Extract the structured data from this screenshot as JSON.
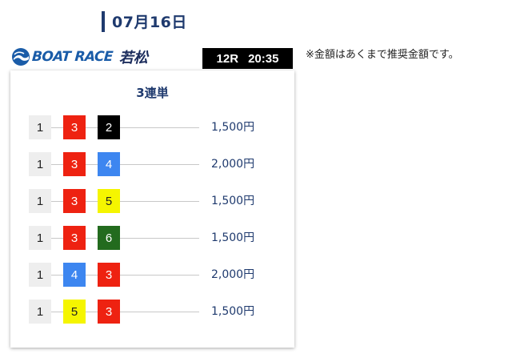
{
  "header": {
    "date": "07月16日"
  },
  "logo": {
    "text": "BOAT RACE",
    "venue": "若松",
    "icon": "boat-race-wave-icon"
  },
  "race": {
    "number": "12R",
    "time": "20:35"
  },
  "note": "※金額はあくまで推奨金額です。",
  "card": {
    "title": "3連単",
    "rows": [
      {
        "first": "1",
        "second": "3",
        "third": "2",
        "amount": "1,500円"
      },
      {
        "first": "1",
        "second": "3",
        "third": "4",
        "amount": "2,000円"
      },
      {
        "first": "1",
        "second": "3",
        "third": "5",
        "amount": "1,500円"
      },
      {
        "first": "1",
        "second": "3",
        "third": "6",
        "amount": "1,500円"
      },
      {
        "first": "1",
        "second": "4",
        "third": "3",
        "amount": "2,000円"
      },
      {
        "first": "1",
        "second": "5",
        "third": "3",
        "amount": "1,500円"
      }
    ]
  },
  "boat_colors": {
    "1": {
      "bg": "#eeeeee",
      "fg": "#222222"
    },
    "2": {
      "bg": "#000000",
      "fg": "#ffffff"
    },
    "3": {
      "bg": "#ee2211",
      "fg": "#ffffff"
    },
    "4": {
      "bg": "#3d86f0",
      "fg": "#ffffff"
    },
    "5": {
      "bg": "#f5f500",
      "fg": "#222222"
    },
    "6": {
      "bg": "#236b1e",
      "fg": "#ffffff"
    }
  }
}
